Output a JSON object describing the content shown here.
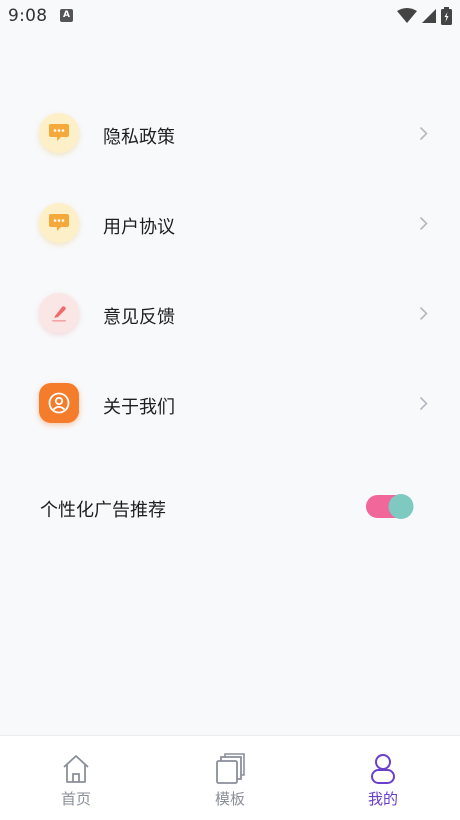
{
  "status_bar": {
    "time": "9:08",
    "notification_icon": "A"
  },
  "menu": {
    "items": [
      {
        "label": "隐私政策",
        "icon": "chat-bubble-icon"
      },
      {
        "label": "用户协议",
        "icon": "chat-bubble-icon"
      },
      {
        "label": "意见反馈",
        "icon": "pencil-icon"
      },
      {
        "label": "关于我们",
        "icon": "user-circle-icon"
      }
    ]
  },
  "settings": {
    "personalized_ads_label": "个性化广告推荐",
    "personalized_ads_enabled": true
  },
  "tab_bar": {
    "tabs": [
      {
        "label": "首页",
        "icon": "home-icon",
        "active": false
      },
      {
        "label": "模板",
        "icon": "layers-icon",
        "active": false
      },
      {
        "label": "我的",
        "icon": "profile-icon",
        "active": true
      }
    ]
  },
  "colors": {
    "active_tab": "#6a3fc9",
    "inactive_tab": "#8a8f99",
    "toggle_track": "#f2679a",
    "toggle_knob": "#7ec9c0",
    "about_icon_bg": "#f57c2b"
  }
}
